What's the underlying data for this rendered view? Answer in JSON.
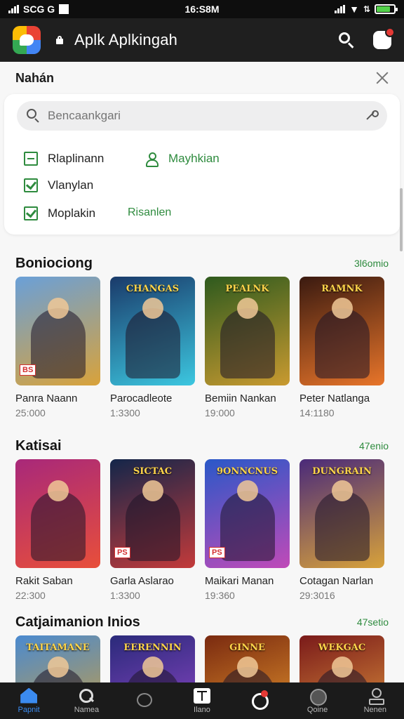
{
  "status": {
    "left": "SCG G",
    "time": "16:S8M"
  },
  "header": {
    "title": "Aplk Aplkingah"
  },
  "panel": {
    "title": "Nahán",
    "search_placeholder": "Bencaankgari"
  },
  "filters": [
    {
      "label": "Rlaplinann",
      "icon": "checkbox-dash"
    },
    {
      "label": "Mayhkian",
      "icon": "person-icon"
    },
    {
      "label": "Vlanylan",
      "icon": "checkbox-checked"
    },
    {
      "label": "Moplakin",
      "icon": "checkbox-dash"
    },
    {
      "label": "Risanlen",
      "icon": "none"
    }
  ],
  "sections": [
    {
      "title": "Boniociong",
      "more": "3l6omio",
      "games": [
        {
          "name": "Panra Naann",
          "count": "25:000",
          "banner": "",
          "badge": "BS",
          "colors": [
            "#6aa0d8",
            "#d9a23a"
          ]
        },
        {
          "name": "Parocadleote",
          "count": "1:3300",
          "banner": "CHANGAS",
          "badge": "",
          "colors": [
            "#1a3a6a",
            "#3cc7e0"
          ]
        },
        {
          "name": "Bemiin Nankan",
          "count": "19:000",
          "banner": "PEALNK",
          "badge": "",
          "colors": [
            "#2e5a1e",
            "#c99a30"
          ]
        },
        {
          "name": "Peter Natlanga",
          "count": "14:1180",
          "banner": "RAMNK",
          "badge": "",
          "colors": [
            "#3a1a10",
            "#e8752a"
          ]
        }
      ]
    },
    {
      "title": "Katisai",
      "more": "47enio",
      "games": [
        {
          "name": "Rakit Saban",
          "count": "22:300",
          "banner": "",
          "badge": "",
          "colors": [
            "#a8287a",
            "#e84f3a"
          ]
        },
        {
          "name": "Garla Aslarao",
          "count": "1:3300",
          "banner": "SICTAC",
          "badge": "PS",
          "colors": [
            "#13264a",
            "#c33a3a"
          ]
        },
        {
          "name": "Maikari Manan",
          "count": "19:360",
          "banner": "9ONNCNUS",
          "badge": "PS",
          "colors": [
            "#2a58c8",
            "#c04ab8"
          ]
        },
        {
          "name": "Cotagan Narlan",
          "count": "29:3016",
          "banner": "DUNGRAIN",
          "badge": "",
          "colors": [
            "#4a2a7a",
            "#d8a23a"
          ]
        }
      ]
    },
    {
      "title": "Catjaimanion Inios",
      "more": "47setio",
      "games": [
        {
          "name": "",
          "count": "",
          "banner": "TAITAMANE",
          "badge": "",
          "colors": [
            "#4a8ad0",
            "#d8a030"
          ]
        },
        {
          "name": "",
          "count": "",
          "banner": "EERENNIN",
          "badge": "",
          "colors": [
            "#2a2a7a",
            "#9a4ad0"
          ]
        },
        {
          "name": "",
          "count": "",
          "banner": "GINNE",
          "badge": "",
          "colors": [
            "#7a2a10",
            "#f0a030"
          ]
        },
        {
          "name": "",
          "count": "",
          "banner": "WEKGAC",
          "badge": "",
          "colors": [
            "#7a1a1a",
            "#e8a040"
          ]
        }
      ]
    }
  ],
  "nav": [
    {
      "label": "Papnit",
      "icon": "home-icon",
      "active": true
    },
    {
      "label": "Namea",
      "icon": "search-icon",
      "active": false
    },
    {
      "label": "",
      "icon": "chat-icon",
      "active": false
    },
    {
      "label": "Ilano",
      "icon": "apps-icon",
      "active": false
    },
    {
      "label": "",
      "icon": "games-icon",
      "active": false
    },
    {
      "label": "Qoine",
      "icon": "circle-icon",
      "active": false
    },
    {
      "label": "Nenen",
      "icon": "user-icon",
      "active": false
    }
  ]
}
